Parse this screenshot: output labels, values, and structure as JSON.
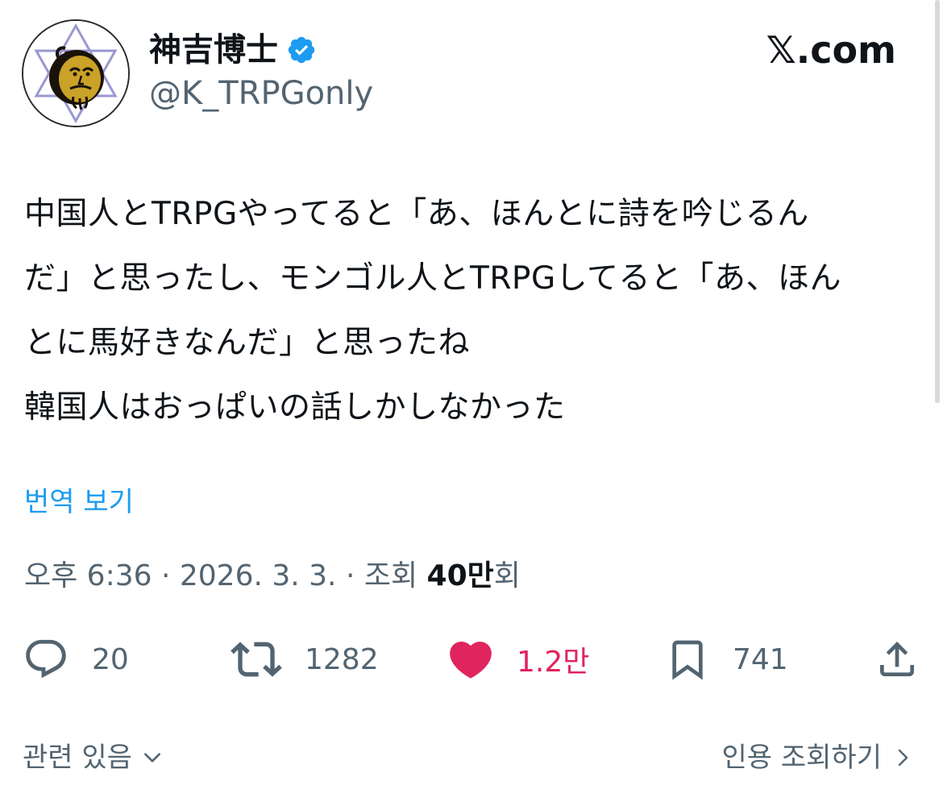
{
  "author": {
    "display_name": "神吉博士",
    "handle": "@K_TRPGonly",
    "verified": true,
    "avatar_icon": "avatar-hexagram-face-icon"
  },
  "brand": {
    "label": "𝕏.com"
  },
  "tweet": {
    "lines": [
      "中国人とTRPGやってると「あ、ほんとに詩を吟じるん",
      "だ」と思ったし、モンゴル人とTRPGしてると「あ、ほん",
      "とに馬好きなんだ」と思ったね",
      "韓国人はおっぱいの話しかしなかった"
    ],
    "translate_label": "번역 보기",
    "timestamp": "오후 6:36 · 2026. 3. 3. · 조회 ",
    "views_count": "40만",
    "views_suffix": "회"
  },
  "actions": {
    "reply_count": "20",
    "retweet_count": "1282",
    "like_count": "1.2만",
    "bookmark_count": "741"
  },
  "footer": {
    "related_label": "관련 있음",
    "quotes_label": "인용 조회하기"
  },
  "colors": {
    "accent": "#1d9bf0",
    "like": "#e0245e",
    "secondary_text": "#536471",
    "primary_text": "#0f1419"
  }
}
